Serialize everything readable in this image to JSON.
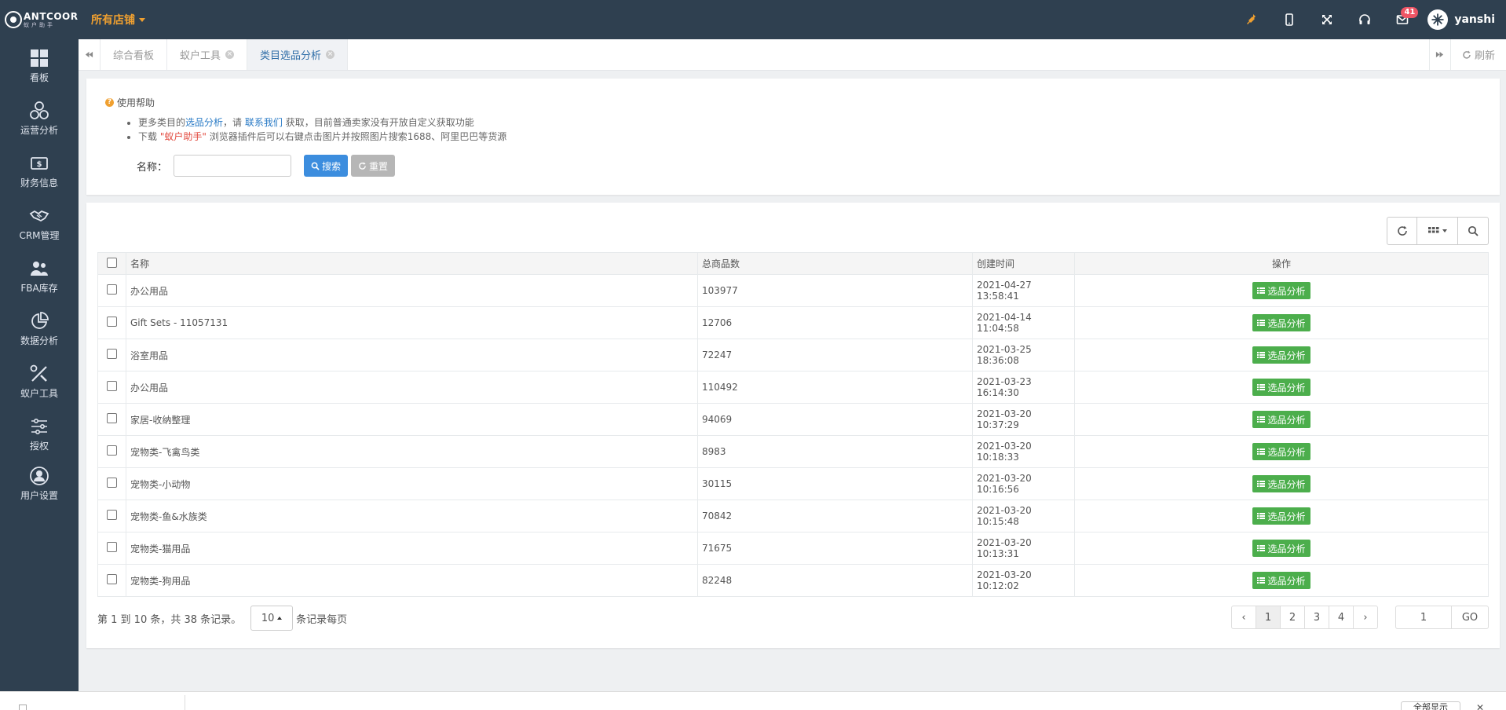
{
  "topbar": {
    "brand": "ANTCOOR",
    "brand_sub": "蚁户助手",
    "store_selector": "所有店铺",
    "mail_badge": "41",
    "username": "yanshi"
  },
  "sidebar": {
    "items": [
      {
        "label": "看板",
        "icon": "dashboard-icon"
      },
      {
        "label": "运营分析",
        "icon": "operations-icon"
      },
      {
        "label": "财务信息",
        "icon": "finance-icon"
      },
      {
        "label": "CRM管理",
        "icon": "handshake-icon"
      },
      {
        "label": "FBA库存",
        "icon": "inventory-icon"
      },
      {
        "label": "数据分析",
        "icon": "pie-chart-icon"
      },
      {
        "label": "蚁户工具",
        "icon": "tools-icon"
      },
      {
        "label": "授权",
        "icon": "sliders-icon"
      },
      {
        "label": "用户设置",
        "icon": "user-icon"
      }
    ]
  },
  "tabs": {
    "items": [
      {
        "label": "综合看板",
        "closable": false
      },
      {
        "label": "蚁户工具",
        "closable": true
      },
      {
        "label": "类目选品分析",
        "closable": true,
        "active": true
      }
    ],
    "refresh_label": "刷新"
  },
  "help": {
    "title": "使用帮助",
    "line1_pre": "更多类目的",
    "line1_link1": "选品分析",
    "line1_mid": "，请 ",
    "line1_link2": "联系我们",
    "line1_post": " 获取，目前普通卖家没有开放自定义获取功能",
    "line2_pre": "下载 ",
    "line2_highlight": "\"蚁户助手\"",
    "line2_post": " 浏览器插件后可以右键点击图片并按照图片搜索1688、阿里巴巴等货源"
  },
  "search": {
    "name_label": "名称：",
    "name_value": "",
    "search_button": "搜索",
    "reset_button": "重置"
  },
  "table": {
    "columns": [
      "名称",
      "总商品数",
      "创建时间",
      "操作"
    ],
    "action_label": "选品分析",
    "rows": [
      {
        "name": "办公用品",
        "count": "103977",
        "created": "2021-04-27 13:58:41"
      },
      {
        "name": "Gift Sets - 11057131",
        "count": "12706",
        "created": "2021-04-14 11:04:58"
      },
      {
        "name": "浴室用品",
        "count": "72247",
        "created": "2021-03-25 18:36:08"
      },
      {
        "name": "办公用品",
        "count": "110492",
        "created": "2021-03-23 16:14:30"
      },
      {
        "name": "家居-收纳整理",
        "count": "94069",
        "created": "2021-03-20 10:37:29"
      },
      {
        "name": "宠物类-飞禽鸟类",
        "count": "8983",
        "created": "2021-03-20 10:18:33"
      },
      {
        "name": "宠物类-小动物",
        "count": "30115",
        "created": "2021-03-20 10:16:56"
      },
      {
        "name": "宠物类-鱼&水族类",
        "count": "70842",
        "created": "2021-03-20 10:15:48"
      },
      {
        "name": "宠物类-猫用品",
        "count": "71675",
        "created": "2021-03-20 10:13:31"
      },
      {
        "name": "宠物类-狗用品",
        "count": "82248",
        "created": "2021-03-20 10:12:02"
      }
    ]
  },
  "pagination": {
    "info": "第 1 到 10 条，共 38 条记录。",
    "page_size": "10",
    "per_page_suffix": "条记录每页",
    "prev": "‹",
    "pages": [
      "1",
      "2",
      "3",
      "4"
    ],
    "next": "›",
    "goto_value": "1",
    "go_label": "GO"
  },
  "bottom": {
    "show_all": "全部显示"
  }
}
